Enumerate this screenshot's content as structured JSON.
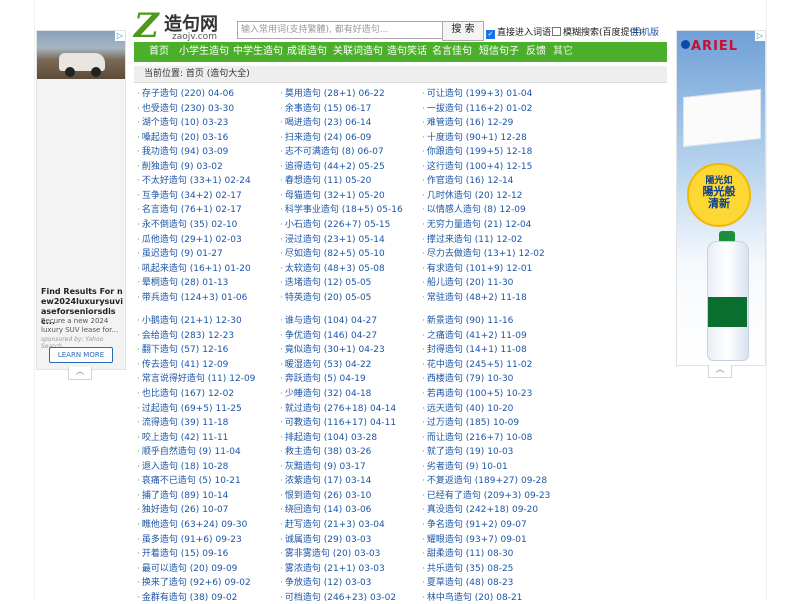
{
  "site": {
    "logo_mark": "Z",
    "logo_name": "造句网",
    "logo_domain": "zaojv.com",
    "search_placeholder": "输入常用词(支持繁體), 都有好造句...",
    "search_button": "搜 索",
    "opt_direct": "直接进入词语页",
    "opt_direct_checked": true,
    "opt_fuzzy": "模糊搜索(百度提供)",
    "opt_fuzzy_checked": false,
    "mobile": "手机版",
    "accent_color": "#4caf2b",
    "link_color": "#1c56a6"
  },
  "nav": [
    "首页",
    "小学生造句",
    "中学生造句",
    "成语造句",
    "关联词造句",
    "造句笑话",
    "名言佳句",
    "短信句子",
    "反馈",
    "其它"
  ],
  "breadcrumb": "当前位置: 首页 (造句大全)",
  "ads": {
    "left": {
      "title": "Find Results For new2024luxurysuviaseforseniorsdisc...",
      "desc": "Secure a new 2024 luxury SUV lease for...",
      "sponsor": "sponsored by: Yahoo Search",
      "button": "LEARN MORE",
      "ctrl": "▷"
    },
    "right": {
      "brand": "ARIEL",
      "circle_top": "陽光如",
      "circle_mid": "陽光般",
      "circle_bot": "清新",
      "ctrl": "▷"
    },
    "collapse_icon": "︿"
  },
  "columns": [
    [
      {
        "title": "存子造句",
        "count": "(220)",
        "date": "04-06"
      },
      {
        "title": "也受造句",
        "count": "(230)",
        "date": "03-30"
      },
      {
        "title": "湖个造句",
        "count": "(10)",
        "date": "03-23"
      },
      {
        "title": "嗓起造句",
        "count": "(20)",
        "date": "03-16"
      },
      {
        "title": "我功造句",
        "count": "(94)",
        "date": "03-09"
      },
      {
        "title": "削独造句",
        "count": "(9)",
        "date": "03-02"
      },
      {
        "title": "不太好造句",
        "count": "(33+1)",
        "date": "02-24"
      },
      {
        "title": "互争造句",
        "count": "(34+2)",
        "date": "02-17"
      },
      {
        "title": "名言造句",
        "count": "(76+1)",
        "date": "02-17"
      },
      {
        "title": "永不倒造句",
        "count": "(35)",
        "date": "02-10"
      },
      {
        "title": "瓜他造句",
        "count": "(29+1)",
        "date": "02-03"
      },
      {
        "title": "虽迟造句",
        "count": "(9)",
        "date": "01-27"
      },
      {
        "title": "吼起来造句",
        "count": "(16+1)",
        "date": "01-20"
      },
      {
        "title": "晕桐造句",
        "count": "(28)",
        "date": "01-13"
      },
      {
        "title": "带兵造句",
        "count": "(124+3)",
        "date": "01-06"
      },
      {
        "title": "小鹅造句",
        "count": "(21+1)",
        "date": "12-30",
        "gap": true
      },
      {
        "title": "会给造句",
        "count": "(283)",
        "date": "12-23"
      },
      {
        "title": "翻下造句",
        "count": "(57)",
        "date": "12-16"
      },
      {
        "title": "传去造句",
        "count": "(41)",
        "date": "12-09"
      },
      {
        "title": "常言说得好造句",
        "count": "(11)",
        "date": "12-09"
      },
      {
        "title": "也比造句",
        "count": "(167)",
        "date": "12-02"
      },
      {
        "title": "过起造句",
        "count": "(69+5)",
        "date": "11-25"
      },
      {
        "title": "流得造句",
        "count": "(39)",
        "date": "11-18"
      },
      {
        "title": "咬上造句",
        "count": "(42)",
        "date": "11-11"
      },
      {
        "title": "顺乎自然造句",
        "count": "(9)",
        "date": "11-04"
      },
      {
        "title": "退入造句",
        "count": "(18)",
        "date": "10-28"
      },
      {
        "title": "哀痛不已造句",
        "count": "(5)",
        "date": "10-21"
      },
      {
        "title": "捕了造句",
        "count": "(89)",
        "date": "10-14"
      },
      {
        "title": "独好造句",
        "count": "(26)",
        "date": "10-07"
      },
      {
        "title": "瞧他造句",
        "count": "(63+24)",
        "date": "09-30"
      },
      {
        "title": "虽多造句",
        "count": "(91+6)",
        "date": "09-23"
      },
      {
        "title": "开着造句",
        "count": "(15)",
        "date": "09-16"
      },
      {
        "title": "最可以造句",
        "count": "(20)",
        "date": "09-09"
      },
      {
        "title": "换来了造句",
        "count": "(92+6)",
        "date": "09-02"
      },
      {
        "title": "金群有造句",
        "count": "(38)",
        "date": "09-02"
      }
    ],
    [
      {
        "title": "莫用造句",
        "count": "(28+1)",
        "date": "06-22"
      },
      {
        "title": "余事造句",
        "count": "(15)",
        "date": "06-17"
      },
      {
        "title": "喝进造句",
        "count": "(23)",
        "date": "06-14"
      },
      {
        "title": "扫来造句",
        "count": "(24)",
        "date": "06-09"
      },
      {
        "title": "志不可满造句",
        "count": "(8)",
        "date": "06-07"
      },
      {
        "title": "追得造句",
        "count": "(44+2)",
        "date": "05-25"
      },
      {
        "title": "春想造句",
        "count": "(11)",
        "date": "05-20"
      },
      {
        "title": "母猫造句",
        "count": "(32+1)",
        "date": "05-20"
      },
      {
        "title": "科学事业造句",
        "count": "(18+5)",
        "date": "05-16"
      },
      {
        "title": "小石造句",
        "count": "(226+7)",
        "date": "05-15"
      },
      {
        "title": "浸过造句",
        "count": "(23+1)",
        "date": "05-14"
      },
      {
        "title": "尽如造句",
        "count": "(82+5)",
        "date": "05-10"
      },
      {
        "title": "太软造句",
        "count": "(48+3)",
        "date": "05-08"
      },
      {
        "title": "迭堵造句",
        "count": "(12)",
        "date": "05-05"
      },
      {
        "title": "特英造句",
        "count": "(20)",
        "date": "05-05"
      },
      {
        "title": "谁与造句",
        "count": "(104)",
        "date": "04-27",
        "gap": true
      },
      {
        "title": "争优造句",
        "count": "(146)",
        "date": "04-27"
      },
      {
        "title": "竟似造句",
        "count": "(30+1)",
        "date": "04-23"
      },
      {
        "title": "暖湿造句",
        "count": "(53)",
        "date": "04-22"
      },
      {
        "title": "奔跃造句",
        "count": "(5)",
        "date": "04-19"
      },
      {
        "title": "少睡造句",
        "count": "(32)",
        "date": "04-18"
      },
      {
        "title": "就过造句",
        "count": "(276+18)",
        "date": "04-14"
      },
      {
        "title": "可教造句",
        "count": "(116+17)",
        "date": "04-11"
      },
      {
        "title": "排起造句",
        "count": "(104)",
        "date": "03-28"
      },
      {
        "title": "救主造句",
        "count": "(38)",
        "date": "03-26"
      },
      {
        "title": "灰黯造句",
        "count": "(9)",
        "date": "03-17"
      },
      {
        "title": "浓紫造句",
        "count": "(17)",
        "date": "03-14"
      },
      {
        "title": "恨到造句",
        "count": "(26)",
        "date": "03-10"
      },
      {
        "title": "绕回造句",
        "count": "(14)",
        "date": "03-06"
      },
      {
        "title": "赶写造句",
        "count": "(21+3)",
        "date": "03-04"
      },
      {
        "title": "诚属造句",
        "count": "(29)",
        "date": "03-03"
      },
      {
        "title": "雾非雾造句",
        "count": "(20)",
        "date": "03-03"
      },
      {
        "title": "雾浓造句",
        "count": "(21+1)",
        "date": "03-03"
      },
      {
        "title": "争放造句",
        "count": "(12)",
        "date": "03-03"
      },
      {
        "title": "可档造句",
        "count": "(246+23)",
        "date": "03-02"
      }
    ],
    [
      {
        "title": "可让造句",
        "count": "(199+3)",
        "date": "01-04"
      },
      {
        "title": "一拔造句",
        "count": "(116+2)",
        "date": "01-02"
      },
      {
        "title": "难管造句",
        "count": "(16)",
        "date": "12-29"
      },
      {
        "title": "十度造句",
        "count": "(90+1)",
        "date": "12-28"
      },
      {
        "title": "你跟造句",
        "count": "(199+5)",
        "date": "12-18"
      },
      {
        "title": "这行造句",
        "count": "(100+4)",
        "date": "12-15"
      },
      {
        "title": "作官造句",
        "count": "(16)",
        "date": "12-14"
      },
      {
        "title": "几时休造句",
        "count": "(20)",
        "date": "12-12"
      },
      {
        "title": "以情感人造句",
        "count": "(8)",
        "date": "12-09"
      },
      {
        "title": "无穷力量造句",
        "count": "(21)",
        "date": "12-04"
      },
      {
        "title": "撑过来造句",
        "count": "(11)",
        "date": "12-02"
      },
      {
        "title": "尽力去做造句",
        "count": "(13+1)",
        "date": "12-02"
      },
      {
        "title": "有求造句",
        "count": "(101+9)",
        "date": "12-01"
      },
      {
        "title": "船儿造句",
        "count": "(20)",
        "date": "11-30"
      },
      {
        "title": "常驻造句",
        "count": "(48+2)",
        "date": "11-18"
      },
      {
        "title": "新景造句",
        "count": "(90)",
        "date": "11-16",
        "gap": true
      },
      {
        "title": "之痛造句",
        "count": "(41+2)",
        "date": "11-09"
      },
      {
        "title": "封得造句",
        "count": "(14+1)",
        "date": "11-08"
      },
      {
        "title": "花中造句",
        "count": "(245+5)",
        "date": "11-02"
      },
      {
        "title": "西楼造句",
        "count": "(79)",
        "date": "10-30"
      },
      {
        "title": "若再造句",
        "count": "(100+5)",
        "date": "10-23"
      },
      {
        "title": "远天造句",
        "count": "(40)",
        "date": "10-20"
      },
      {
        "title": "过万造句",
        "count": "(185)",
        "date": "10-09"
      },
      {
        "title": "而让造句",
        "count": "(216+7)",
        "date": "10-08"
      },
      {
        "title": "就了造句",
        "count": "(19)",
        "date": "10-03"
      },
      {
        "title": "劣者造句",
        "count": "(9)",
        "date": "10-01"
      },
      {
        "title": "不复返造句",
        "count": "(189+27)",
        "date": "09-28"
      },
      {
        "title": "已经有了造句",
        "count": "(209+3)",
        "date": "09-23"
      },
      {
        "title": "真没造句",
        "count": "(242+18)",
        "date": "09-20"
      },
      {
        "title": "争名造句",
        "count": "(91+2)",
        "date": "09-07"
      },
      {
        "title": "耀眼造句",
        "count": "(93+7)",
        "date": "09-01"
      },
      {
        "title": "甜柔造句",
        "count": "(11)",
        "date": "08-30"
      },
      {
        "title": "共乐造句",
        "count": "(35)",
        "date": "08-25"
      },
      {
        "title": "夏草造句",
        "count": "(48)",
        "date": "08-23"
      },
      {
        "title": "林中鸟造句",
        "count": "(20)",
        "date": "08-21"
      }
    ]
  ]
}
